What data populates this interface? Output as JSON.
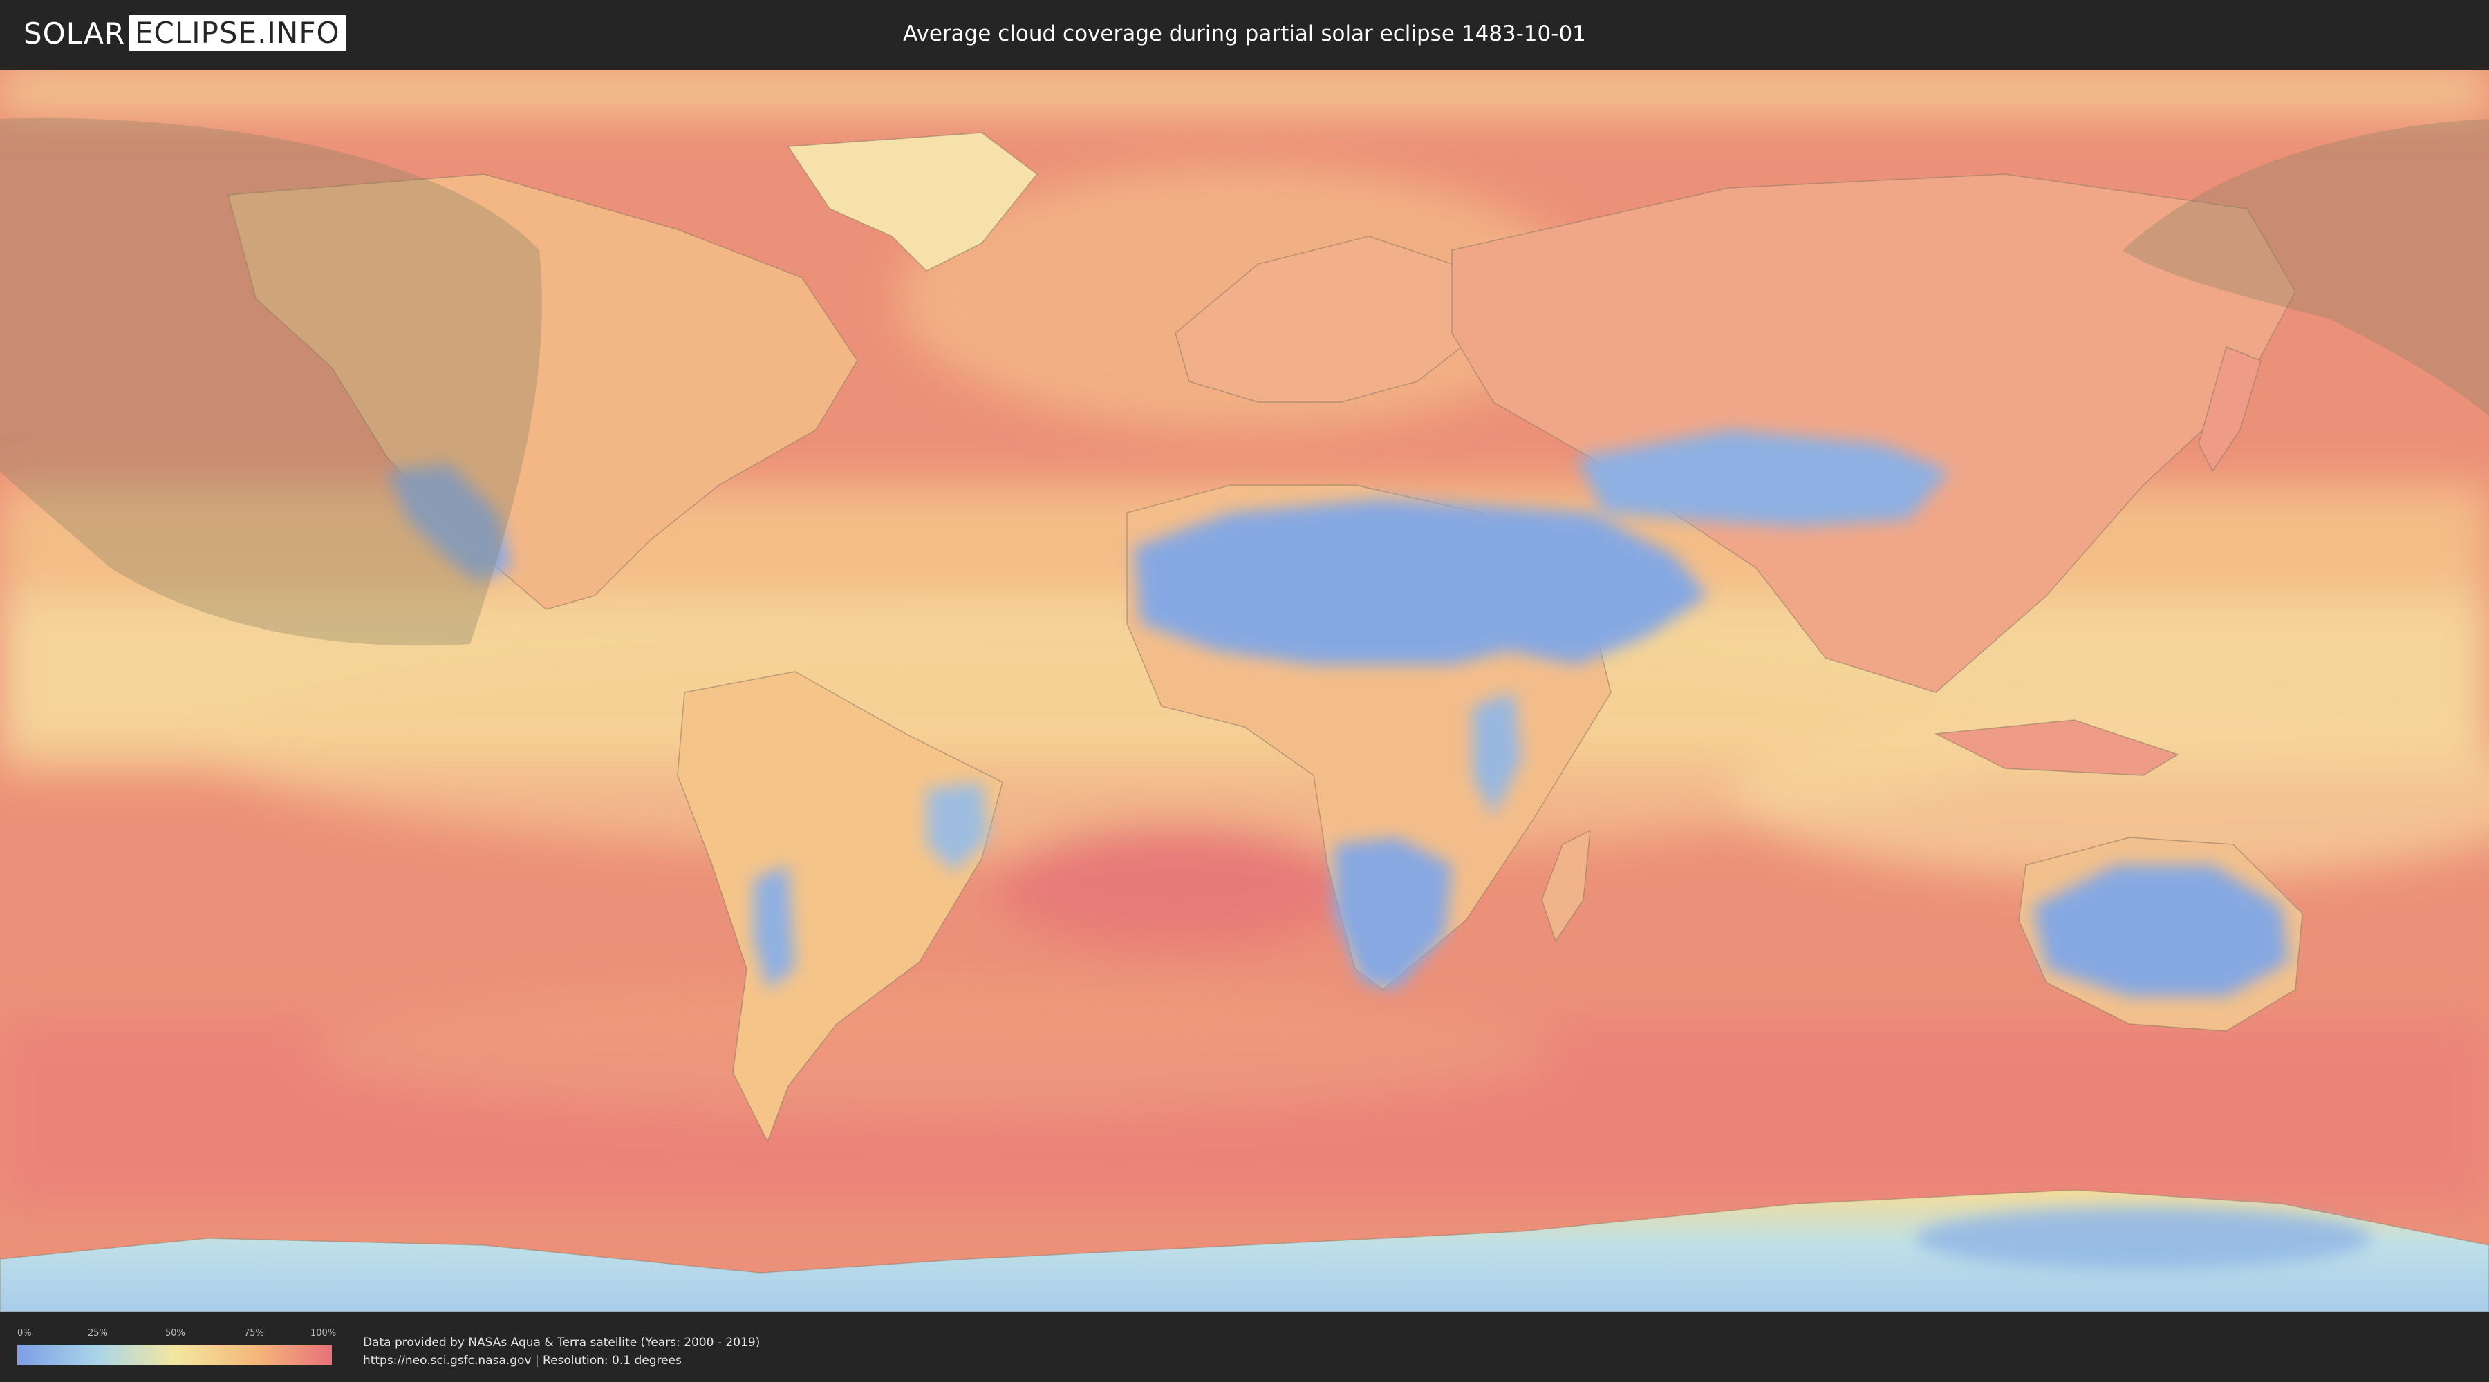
{
  "header": {
    "logo_part1": "SOLAR",
    "logo_part2": "ECLIPSE.INFO",
    "title": "Average cloud coverage during partial solar eclipse 1483-10-01"
  },
  "legend": {
    "ticks": [
      "0%",
      "25%",
      "50%",
      "75%",
      "100%"
    ],
    "colors": [
      "#7f9ee6",
      "#a9d4e8",
      "#f3e6a0",
      "#f5b97a",
      "#e8727a"
    ]
  },
  "footer": {
    "line1": "Data provided by NASAs Aqua & Terra satellite (Years: 2000 - 2019)",
    "line2": "https://neo.sci.gsfc.nasa.gov | Resolution: 0.1 degrees"
  },
  "colors": {
    "bar_background": "#252525",
    "ocean_cloudy": "#eb8a7c",
    "clear_sky": "#86a8e0",
    "eclipse_overlay": "#8a8064"
  }
}
